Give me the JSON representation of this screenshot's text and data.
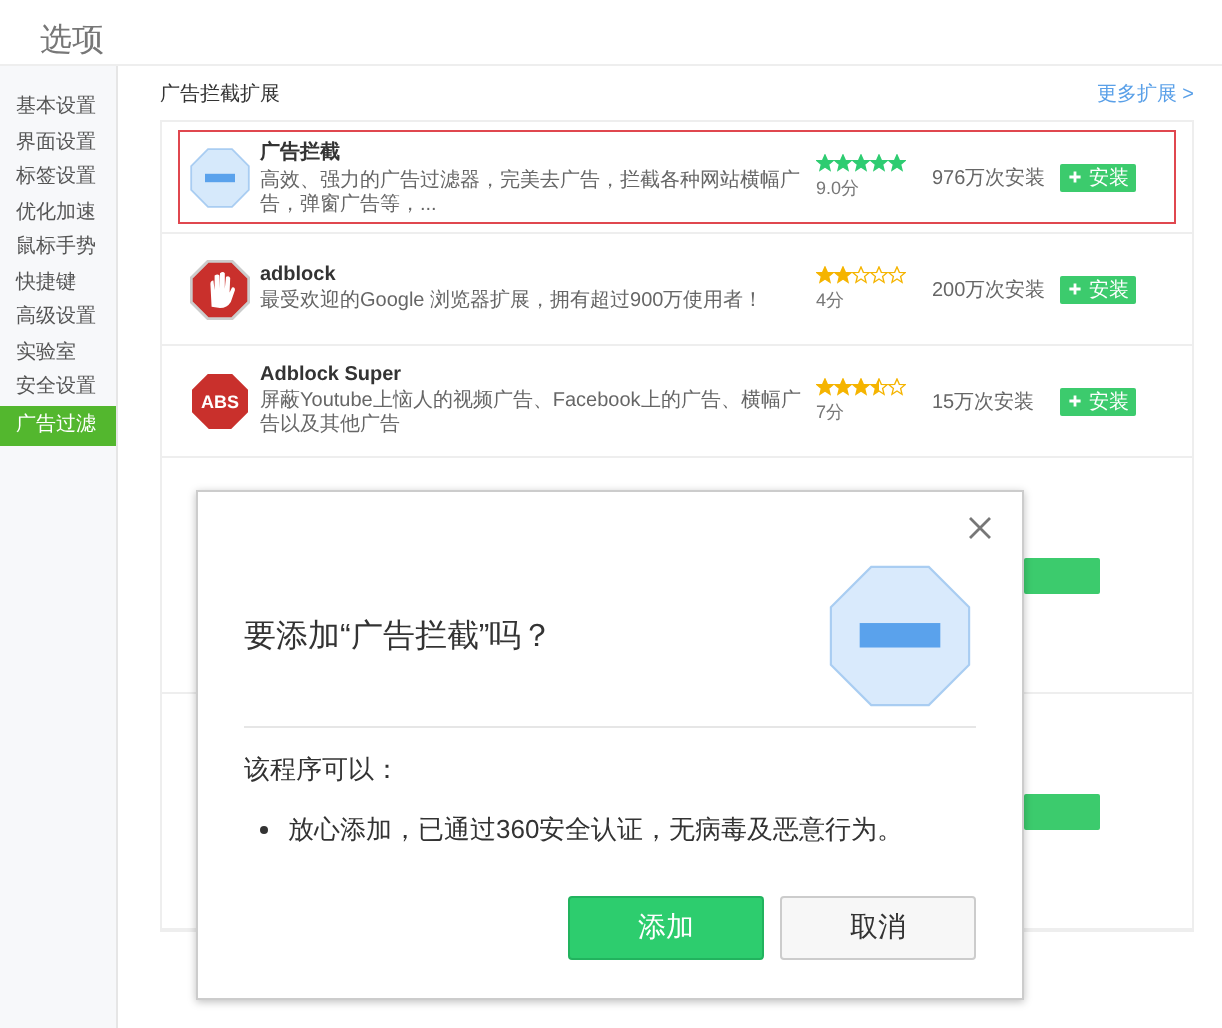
{
  "page_title": "选项",
  "sidebar": {
    "items": [
      {
        "label": "基本设置",
        "selected": false
      },
      {
        "label": "界面设置",
        "selected": false
      },
      {
        "label": "标签设置",
        "selected": false
      },
      {
        "label": "优化加速",
        "selected": false
      },
      {
        "label": "鼠标手势",
        "selected": false
      },
      {
        "label": "快捷键",
        "selected": false
      },
      {
        "label": "高级设置",
        "selected": false
      },
      {
        "label": "实验室",
        "selected": false
      },
      {
        "label": "安全设置",
        "selected": false
      },
      {
        "label": "广告过滤",
        "selected": true
      }
    ]
  },
  "section": {
    "title": "广告拦截扩展",
    "more_link": "更多扩展 >"
  },
  "extensions": [
    {
      "kind": "minus",
      "name": "广告拦截",
      "description": "高效、强力的广告过滤器，完美去广告，拦截各种网站横幅广告，弹窗广告等，...",
      "stars": 5,
      "score": "9.0分",
      "installs": "976万次安装",
      "button": "安装",
      "selected": true
    },
    {
      "kind": "hand",
      "name": "adblock",
      "description": "最受欢迎的Google 浏览器扩展，拥有超过900万使用者！",
      "stars": 2,
      "score": "4分",
      "installs": "200万次安装",
      "button": "安装",
      "selected": false
    },
    {
      "kind": "badge",
      "badge": "ABS",
      "name": "Adblock Super",
      "description": "屏蔽Youtube上恼人的视频广告、Facebook上的广告、横幅广告以及其他广告",
      "stars": 3.5,
      "score": "7分",
      "installs": "15万次安装",
      "button": "安装",
      "selected": false
    }
  ],
  "covered_rows": [
    {
      "kind": "partial"
    },
    {
      "kind": "partial"
    }
  ],
  "dialog": {
    "title": "要添加“广告拦截”吗？",
    "subtitle": "该程序可以：",
    "bullets": [
      "放心添加，已通过360安全认证，无病毒及恶意行为。"
    ],
    "buttons": [
      {
        "label": "添加",
        "kind": "primary"
      },
      {
        "label": "取消",
        "kind": "secondary"
      }
    ]
  }
}
